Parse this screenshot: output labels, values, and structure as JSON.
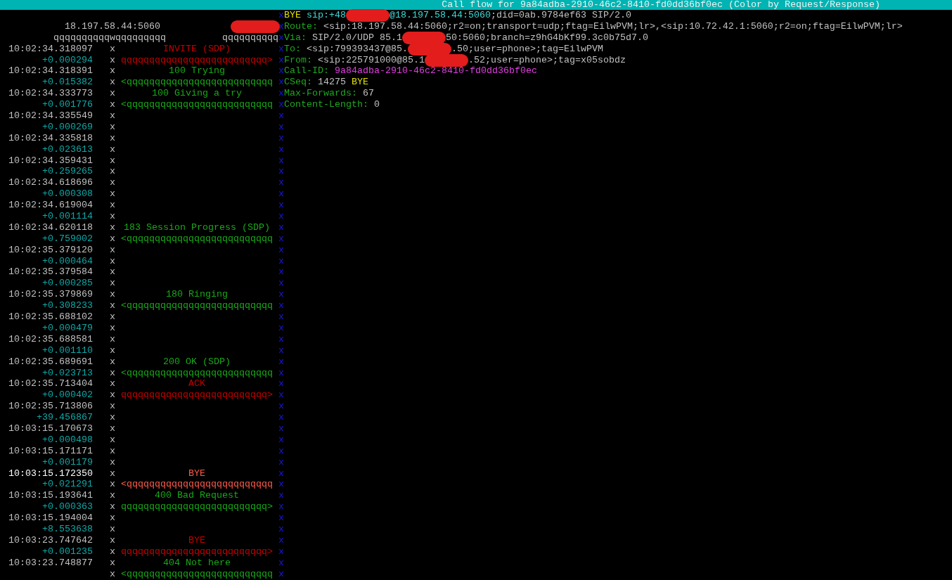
{
  "title": "Call flow for 9a84adba-2910-46c2-8410-fd0dd36bf0ec (Color by Request/Response)",
  "hosts": [
    {
      "kind": "address",
      "text": "18.197.58.44:5060"
    },
    {
      "kind": "redaction"
    }
  ],
  "lifelines": [
    "qqqqqqqqqqwqqqqqqqqq",
    "qqqqqqqqqq"
  ],
  "flow": [
    {
      "time": "10:02:34.318097",
      "delta": "+0.000294",
      "rules": [
        "x",
        "x"
      ],
      "selected": false,
      "message": {
        "label": "INVITE (SDP)",
        "arrow": "qqqqqqqqqqqqqqqqqqqqqqqqqq>",
        "kind": "request"
      }
    },
    {
      "time": "10:02:34.318391",
      "delta": "+0.015382",
      "rules": [
        "x",
        "x"
      ],
      "selected": false,
      "message": {
        "label": "100 Trying",
        "arrow": "<qqqqqqqqqqqqqqqqqqqqqqqqqq",
        "kind": "response"
      }
    },
    {
      "time": "10:02:34.333773",
      "delta": "+0.001776",
      "rules": [
        "x",
        "x"
      ],
      "selected": false,
      "message": {
        "label": "100 Giving a try",
        "arrow": "<qqqqqqqqqqqqqqqqqqqqqqqqqq",
        "kind": "response"
      }
    },
    {
      "time": "10:02:34.335549",
      "delta": "+0.000269",
      "rules": [
        "x",
        "x"
      ],
      "selected": false
    },
    {
      "time": "10:02:34.335818",
      "delta": "+0.023613",
      "rules": [
        "x",
        "x"
      ],
      "selected": false
    },
    {
      "time": "10:02:34.359431",
      "delta": "+0.259265",
      "rules": [
        "x",
        "x"
      ],
      "selected": false
    },
    {
      "time": "10:02:34.618696",
      "delta": "+0.000308",
      "rules": [
        "x",
        "x"
      ],
      "selected": false
    },
    {
      "time": "10:02:34.619004",
      "delta": "+0.001114",
      "rules": [
        "x",
        "x"
      ],
      "selected": false
    },
    {
      "time": "10:02:34.620118",
      "delta": "+0.759002",
      "rules": [
        "x",
        "x"
      ],
      "selected": false,
      "message": {
        "label": "183 Session Progress (SDP)",
        "arrow": "<qqqqqqqqqqqqqqqqqqqqqqqqqq",
        "kind": "response"
      }
    },
    {
      "time": "10:02:35.379120",
      "delta": "+0.000464",
      "rules": [
        "x",
        "x"
      ],
      "selected": false
    },
    {
      "time": "10:02:35.379584",
      "delta": "+0.000285",
      "rules": [
        "x",
        "x"
      ],
      "selected": false
    },
    {
      "time": "10:02:35.379869",
      "delta": "+0.308233",
      "rules": [
        "x",
        "x"
      ],
      "selected": false,
      "message": {
        "label": "180 Ringing",
        "arrow": "<qqqqqqqqqqqqqqqqqqqqqqqqqq",
        "kind": "response"
      }
    },
    {
      "time": "10:02:35.688102",
      "delta": "+0.000479",
      "rules": [
        "x",
        "x"
      ],
      "selected": false
    },
    {
      "time": "10:02:35.688581",
      "delta": "+0.001110",
      "rules": [
        "x",
        "x"
      ],
      "selected": false
    },
    {
      "time": "10:02:35.689691",
      "delta": "+0.023713",
      "rules": [
        "x",
        "x"
      ],
      "selected": false,
      "message": {
        "label": "200 OK (SDP)",
        "arrow": "<qqqqqqqqqqqqqqqqqqqqqqqqqq",
        "kind": "response"
      }
    },
    {
      "time": "10:02:35.713404",
      "delta": "+0.000402",
      "rules": [
        "x",
        "x"
      ],
      "selected": false,
      "message": {
        "label": "ACK",
        "arrow": "qqqqqqqqqqqqqqqqqqqqqqqqqq>",
        "kind": "request"
      }
    },
    {
      "time": "10:02:35.713806",
      "delta": "+39.456867",
      "rules": [
        "x",
        "x"
      ],
      "selected": false
    },
    {
      "time": "10:03:15.170673",
      "delta": "+0.000498",
      "rules": [
        "x",
        "x"
      ],
      "selected": false
    },
    {
      "time": "10:03:15.171171",
      "delta": "+0.001179",
      "rules": [
        "x",
        "x"
      ],
      "selected": false
    },
    {
      "time": "10:03:15.172350",
      "delta": "+0.021291",
      "rules": [
        "x",
        "x"
      ],
      "selected": true,
      "message": {
        "label": "BYE",
        "arrow": "<qqqqqqqqqqqqqqqqqqqqqqqqqq",
        "kind": "request"
      }
    },
    {
      "time": "10:03:15.193641",
      "delta": "+0.000363",
      "rules": [
        "x",
        "x"
      ],
      "selected": false,
      "message": {
        "label": "400 Bad Request",
        "arrow": "qqqqqqqqqqqqqqqqqqqqqqqqqq>",
        "kind": "response"
      }
    },
    {
      "time": "10:03:15.194004",
      "delta": "+8.553638",
      "rules": [
        "x",
        "x"
      ],
      "selected": false
    },
    {
      "time": "10:03:23.747642",
      "delta": "+0.001235",
      "rules": [
        "x",
        "x"
      ],
      "selected": false,
      "message": {
        "label": "BYE",
        "arrow": "qqqqqqqqqqqqqqqqqqqqqqqqqq>",
        "kind": "request"
      }
    },
    {
      "time": "10:03:23.748877",
      "rules": [
        "x",
        "x"
      ],
      "selected": false,
      "message": {
        "label": "404 Not here",
        "arrow": "<qqqqqqqqqqqqqqqqqqqqqqqqqq",
        "kind": "response"
      }
    }
  ],
  "pane_divider": [
    "x",
    "x",
    "x",
    "x",
    "x",
    "x",
    "x",
    "x",
    "x",
    "x",
    "x",
    "x",
    "x",
    "x",
    "x",
    "x",
    "x",
    "x",
    "x",
    "x",
    "x",
    "x",
    "x",
    "x",
    "x",
    "x",
    "x",
    "x",
    "x",
    "x",
    "x",
    "x",
    "x",
    "x",
    "x",
    "x",
    "x",
    "x",
    "x",
    "x",
    "x",
    "x",
    "x",
    "x",
    "x",
    "x",
    "x",
    "x",
    "x",
    "x",
    "x"
  ],
  "message_lines": [
    [
      {
        "kind": "method",
        "text": "BYE"
      },
      {
        "kind": "uri",
        "text": " sip:+48"
      },
      {
        "kind": "redaction"
      },
      {
        "kind": "uri",
        "text": "@18.197.58.44:5060"
      },
      {
        "kind": "value",
        "text": ";did=0ab.9784ef63 SIP/2.0"
      }
    ],
    [
      {
        "kind": "name",
        "text": "Route:"
      },
      {
        "kind": "value",
        "text": " <sip:18.197.58.44:5060;r2=on;transport=udp;ftag=EilwPVM;lr>,<sip:10.72.42.1:5060;r2=on;ftag=EilwPVM;lr>"
      }
    ],
    [
      {
        "kind": "name",
        "text": "Via:"
      },
      {
        "kind": "value",
        "text": " SIP/2.0/UDP 85.1"
      },
      {
        "kind": "redaction"
      },
      {
        "kind": "value",
        "text": "50:5060;branch=z9hG4bKf99.3c0b75d7.0"
      }
    ],
    [
      {
        "kind": "name",
        "text": "To:"
      },
      {
        "kind": "value",
        "text": " <sip:799393437@85."
      },
      {
        "kind": "redaction"
      },
      {
        "kind": "value",
        "text": ".50;user=phone>;tag=EilwPVM"
      }
    ],
    [
      {
        "kind": "name",
        "text": "From:"
      },
      {
        "kind": "value",
        "text": " <sip:225791000@85.1"
      },
      {
        "kind": "redaction"
      },
      {
        "kind": "value",
        "text": ".52;user=phone>;tag=x05sobdz"
      }
    ],
    [
      {
        "kind": "name",
        "text": "Call-ID:"
      },
      {
        "kind": "callid",
        "text": " 9a84adba-2910-46c2-8410-fd0dd36bf0ec"
      }
    ],
    [
      {
        "kind": "name",
        "text": "CSeq:"
      },
      {
        "kind": "value",
        "text": " 14275 "
      },
      {
        "kind": "method",
        "text": "BYE"
      }
    ],
    [
      {
        "kind": "name",
        "text": "Max-Forwards:"
      },
      {
        "kind": "value",
        "text": " 67"
      }
    ],
    [
      {
        "kind": "name",
        "text": "Content-Length:"
      },
      {
        "kind": "value",
        "text": " 0"
      }
    ]
  ]
}
